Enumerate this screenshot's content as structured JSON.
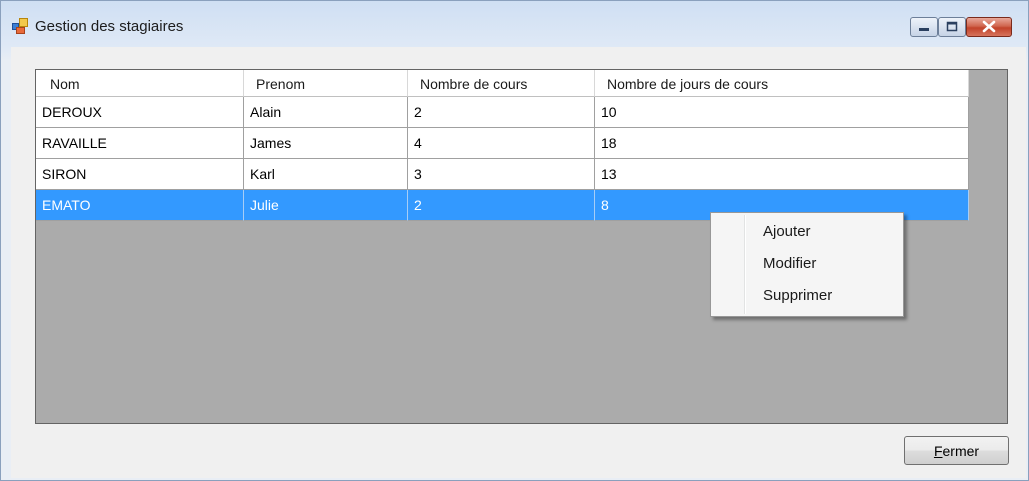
{
  "window": {
    "title": "Gestion des stagiaires"
  },
  "grid": {
    "columns": [
      "Nom",
      "Prenom",
      "Nombre de cours",
      "Nombre de jours de cours"
    ],
    "rows": [
      [
        "DEROUX",
        "Alain",
        "2",
        "10"
      ],
      [
        "RAVAILLE",
        "James",
        "4",
        "18"
      ],
      [
        "SIRON",
        "Karl",
        "3",
        "13"
      ],
      [
        "EMATO",
        "Julie",
        "2",
        "8"
      ]
    ],
    "selected_row_index": 3
  },
  "context_menu": {
    "items": [
      "Ajouter",
      "Modifier",
      "Supprimer"
    ]
  },
  "footer": {
    "close_button": {
      "mnemonic": "F",
      "rest": "ermer"
    }
  },
  "colors": {
    "selection": "#3399ff",
    "grid_background": "#ababab",
    "close_button_red": "#c2432a"
  },
  "icons": [
    "app-window-icon",
    "minimize-icon",
    "maximize-icon",
    "close-icon"
  ]
}
